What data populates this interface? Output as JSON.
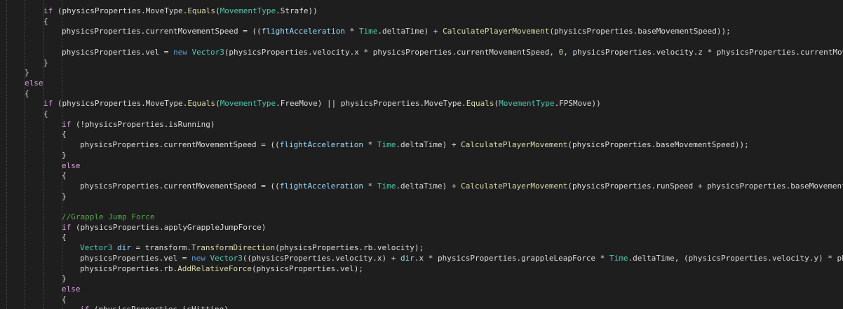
{
  "editor": {
    "colors": {
      "background": "#1e1e1e",
      "text": "#dcdcdc",
      "keyword": "#d8a0df",
      "keyword_blue": "#569cd6",
      "type": "#4ec9b0",
      "method": "#dcdcaa",
      "field": "#9cdcfe",
      "number": "#b5cea8",
      "comment": "#57a64a",
      "indent_guide": "#4a4a4a"
    },
    "lines": [
      {
        "indent": 2,
        "tokens": [
          [
            "keyword",
            "if"
          ],
          [
            "default",
            " (physicsProperties."
          ],
          [
            "default",
            "MoveType"
          ],
          [
            "default",
            "."
          ],
          [
            "method",
            "Equals"
          ],
          [
            "default",
            "("
          ],
          [
            "type",
            "MovementType"
          ],
          [
            "default",
            "."
          ],
          [
            "default",
            "Strafe"
          ],
          [
            "default",
            "))"
          ]
        ]
      },
      {
        "indent": 2,
        "tokens": [
          [
            "default",
            "{"
          ]
        ]
      },
      {
        "indent": 3,
        "tokens": [
          [
            "default",
            "physicsProperties.currentMovementSpeed = (("
          ],
          [
            "field",
            "flightAcceleration"
          ],
          [
            "default",
            " * "
          ],
          [
            "type",
            "Time"
          ],
          [
            "default",
            ".deltaTime) + "
          ],
          [
            "method",
            "CalculatePlayerMovement"
          ],
          [
            "default",
            "(physicsProperties.baseMovementSpeed));"
          ]
        ]
      },
      {
        "indent": 0,
        "tokens": []
      },
      {
        "indent": 3,
        "tokens": [
          [
            "default",
            "physicsProperties.vel = "
          ],
          [
            "keyword-blue",
            "new"
          ],
          [
            "default",
            " "
          ],
          [
            "type",
            "Vector3"
          ],
          [
            "default",
            "(physicsProperties.velocity.x * physicsProperties.currentMovementSpeed, "
          ],
          [
            "number",
            "0"
          ],
          [
            "default",
            ", physicsProperties.velocity.z * physicsProperties.currentMovementSpeed);"
          ]
        ]
      },
      {
        "indent": 2,
        "tokens": [
          [
            "default",
            "}"
          ]
        ]
      },
      {
        "indent": 1,
        "tokens": [
          [
            "default",
            "}"
          ]
        ]
      },
      {
        "indent": 1,
        "tokens": [
          [
            "keyword",
            "else"
          ]
        ]
      },
      {
        "indent": 1,
        "tokens": [
          [
            "default",
            "{"
          ]
        ]
      },
      {
        "indent": 2,
        "tokens": [
          [
            "keyword",
            "if"
          ],
          [
            "default",
            " (physicsProperties."
          ],
          [
            "default",
            "MoveType"
          ],
          [
            "default",
            "."
          ],
          [
            "method",
            "Equals"
          ],
          [
            "default",
            "("
          ],
          [
            "type",
            "MovementType"
          ],
          [
            "default",
            ".FreeMove) || physicsProperties."
          ],
          [
            "default",
            "MoveType"
          ],
          [
            "default",
            "."
          ],
          [
            "method",
            "Equals"
          ],
          [
            "default",
            "("
          ],
          [
            "type",
            "MovementType"
          ],
          [
            "default",
            ".FPSMove))"
          ]
        ]
      },
      {
        "indent": 2,
        "tokens": [
          [
            "default",
            "{"
          ]
        ]
      },
      {
        "indent": 3,
        "tokens": [
          [
            "keyword",
            "if"
          ],
          [
            "default",
            " (!physicsProperties.isRunning)"
          ]
        ]
      },
      {
        "indent": 3,
        "tokens": [
          [
            "default",
            "{"
          ]
        ]
      },
      {
        "indent": 4,
        "tokens": [
          [
            "default",
            "physicsProperties.currentMovementSpeed = (("
          ],
          [
            "field",
            "flightAcceleration"
          ],
          [
            "default",
            " * "
          ],
          [
            "type",
            "Time"
          ],
          [
            "default",
            ".deltaTime) + "
          ],
          [
            "method",
            "CalculatePlayerMovement"
          ],
          [
            "default",
            "(physicsProperties.baseMovementSpeed));"
          ]
        ]
      },
      {
        "indent": 3,
        "tokens": [
          [
            "default",
            "}"
          ]
        ]
      },
      {
        "indent": 3,
        "tokens": [
          [
            "keyword",
            "else"
          ]
        ]
      },
      {
        "indent": 3,
        "tokens": [
          [
            "default",
            "{"
          ]
        ]
      },
      {
        "indent": 4,
        "tokens": [
          [
            "default",
            "physicsProperties.currentMovementSpeed = (("
          ],
          [
            "field",
            "flightAcceleration"
          ],
          [
            "default",
            " * "
          ],
          [
            "type",
            "Time"
          ],
          [
            "default",
            ".deltaTime) + "
          ],
          [
            "method",
            "CalculatePlayerMovement"
          ],
          [
            "default",
            "(physicsProperties.runSpeed + physicsProperties.baseMovementSpeed));"
          ]
        ]
      },
      {
        "indent": 3,
        "tokens": [
          [
            "default",
            "}"
          ]
        ]
      },
      {
        "indent": 0,
        "tokens": []
      },
      {
        "indent": 3,
        "tokens": [
          [
            "comment",
            "//Grapple Jump Force"
          ]
        ]
      },
      {
        "indent": 3,
        "tokens": [
          [
            "keyword",
            "if"
          ],
          [
            "default",
            " (physicsProperties.applyGrappleJumpForce)"
          ]
        ]
      },
      {
        "indent": 3,
        "tokens": [
          [
            "default",
            "{"
          ]
        ]
      },
      {
        "indent": 4,
        "tokens": [
          [
            "type",
            "Vector3"
          ],
          [
            "default",
            " "
          ],
          [
            "field",
            "dir"
          ],
          [
            "default",
            " = transform."
          ],
          [
            "method",
            "TransformDirection"
          ],
          [
            "default",
            "(physicsProperties.rb.velocity);"
          ]
        ]
      },
      {
        "indent": 4,
        "tokens": [
          [
            "default",
            "physicsProperties.vel = "
          ],
          [
            "keyword-blue",
            "new"
          ],
          [
            "default",
            " "
          ],
          [
            "type",
            "Vector3"
          ],
          [
            "default",
            "((physicsProperties.velocity.x) + "
          ],
          [
            "field",
            "dir"
          ],
          [
            "default",
            ".x * physicsProperties.grappleLeapForce * "
          ],
          [
            "type",
            "Time"
          ],
          [
            "default",
            ".deltaTime, (physicsProperties.velocity.y) * physicsProperties.grappleLeapForce);"
          ]
        ]
      },
      {
        "indent": 4,
        "tokens": [
          [
            "default",
            "physicsProperties.rb."
          ],
          [
            "method",
            "AddRelativeForce"
          ],
          [
            "default",
            "(physicsProperties.vel);"
          ]
        ]
      },
      {
        "indent": 3,
        "tokens": [
          [
            "default",
            "}"
          ]
        ]
      },
      {
        "indent": 3,
        "tokens": [
          [
            "keyword",
            "else"
          ]
        ]
      },
      {
        "indent": 3,
        "tokens": [
          [
            "default",
            "{"
          ]
        ]
      },
      {
        "indent": 4,
        "tokens": [
          [
            "keyword",
            "if"
          ],
          [
            "default",
            " (physicsProperties.isHitting)"
          ]
        ]
      }
    ]
  }
}
